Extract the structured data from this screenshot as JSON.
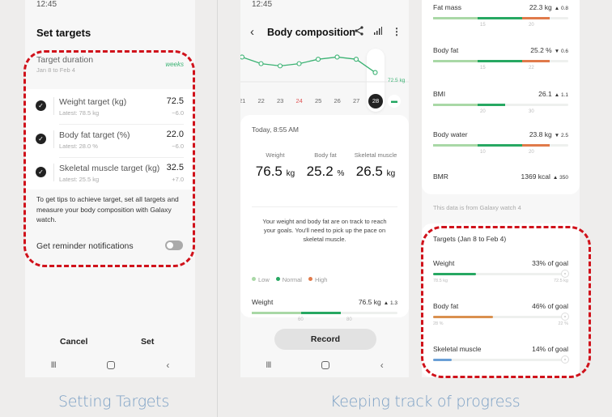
{
  "colors": {
    "accent_green": "#3bb273",
    "low": "#a9d8a6",
    "normal": "#27a862",
    "high": "#e07a4a",
    "fat_target": "#d9904f",
    "muscle_target": "#6a9fd6",
    "highlight_dash": "#d0121b",
    "caption": "#7a9fc4"
  },
  "captions": {
    "left": "Setting Targets",
    "right": "Keeping track of progress"
  },
  "set_targets_screen": {
    "status_time": "12:45",
    "title": "Set targets",
    "duration": {
      "label": "Target duration",
      "range": "Jan 8 to  Feb 4",
      "value": "weeks"
    },
    "targets": [
      {
        "label": "Weight target (kg)",
        "latest": "Latest: 78.5 kg",
        "value": "72.5",
        "delta": "−6.0",
        "checked": true
      },
      {
        "label": "Body fat target (%)",
        "latest": "Latest: 28.0 %",
        "value": "22.0",
        "delta": "−6.0",
        "checked": true
      },
      {
        "label": "Skeletal muscle target (kg)",
        "latest": "Latest: 25.5 kg",
        "value": "32.5",
        "delta": "+7.0",
        "checked": true
      }
    ],
    "tip": "To get tips to achieve target, set all targets and measure your body composition with Galaxy watch.",
    "reminder_label": "Get reminder notifications",
    "reminder_on": false,
    "cancel_label": "Cancel",
    "set_label": "Set"
  },
  "body_comp_screen": {
    "status_time": "12:45",
    "title": "Body composition",
    "icons": [
      "back-icon",
      "share-icon",
      "chart-icon",
      "more-icon"
    ],
    "trend_days": [
      "21",
      "22",
      "23",
      "24",
      "25",
      "26",
      "27",
      "28"
    ],
    "highlight_day": "24",
    "selected_day": "28",
    "trend_target_label": "72.5 kg",
    "trend_values_kg": [
      77.2,
      76.9,
      76.8,
      76.9,
      77.1,
      77.2,
      77.1,
      76.5
    ],
    "timestamp": "Today, 8:55 AM",
    "metrics": [
      {
        "label": "Weight",
        "value": "76.5",
        "unit": "kg",
        "active": true
      },
      {
        "label": "Body fat",
        "value": "25.2",
        "unit": "%",
        "active": false
      },
      {
        "label": "Skeletal muscle",
        "value": "26.5",
        "unit": "kg",
        "active": false
      }
    ],
    "message": "Your weight and body fat are on track to reach your goals. You'll need to pick up the pace on skeletal muscle.",
    "legend": [
      "Low",
      "Normal",
      "High"
    ],
    "weight_row": {
      "label": "Weight",
      "value": "76.5 kg",
      "change": "▲ 1.3",
      "ticks": [
        "60",
        "80"
      ]
    },
    "record_label": "Record"
  },
  "details_screen": {
    "metrics": [
      {
        "label": "Fat mass",
        "value": "22.3 kg",
        "change": "▲ 0.8",
        "ticks": [
          "15",
          "20"
        ],
        "has_high": true,
        "level": 0.86
      },
      {
        "label": "Body fat",
        "value": "25.2 %",
        "change": "▼ 0.6",
        "ticks": [
          "15",
          "22"
        ],
        "has_high": true,
        "level": 0.86
      },
      {
        "label": "BMI",
        "value": "26.1",
        "change": "▲ 1.1",
        "ticks": [
          "20",
          "30"
        ],
        "has_high": false,
        "level": 0.53
      },
      {
        "label": "Body water",
        "value": "23.8 kg",
        "change": "▼ 2.5",
        "ticks": [
          "10",
          "20"
        ],
        "has_high": true,
        "level": 0.86
      },
      {
        "label": "BMR",
        "value": "1369 kcal",
        "change": "▲ 350"
      }
    ],
    "source_note": "This data is from Galaxy watch 4",
    "targets_title": "Targets (Jan 8 to Feb 4)",
    "targets": [
      {
        "label": "Weight",
        "progress_text": "33% of goal",
        "progress": 0.33,
        "from": "78.5 kg",
        "to": "72.5 kg"
      },
      {
        "label": "Body fat",
        "progress_text": "46% of goal",
        "progress": 0.46,
        "from": "28 %",
        "to": "22 %"
      },
      {
        "label": "Skeletal muscle",
        "progress_text": "14% of goal",
        "progress": 0.14,
        "from": "",
        "to": ""
      }
    ]
  }
}
